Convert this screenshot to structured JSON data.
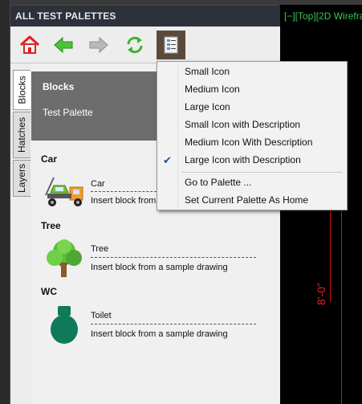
{
  "palette": {
    "title": "ALL TEST PALETTES",
    "toolbar": {
      "buttons": [
        {
          "name": "home",
          "icon": "home-icon"
        },
        {
          "name": "back",
          "icon": "arrow-left-icon"
        },
        {
          "name": "forward",
          "icon": "arrow-right-icon"
        },
        {
          "name": "refresh",
          "icon": "refresh-icon"
        },
        {
          "name": "view-options",
          "icon": "view-options-icon"
        }
      ]
    },
    "tabs": [
      "Blocks",
      "Hatches",
      "Layers"
    ],
    "active_tab": "Blocks",
    "header": {
      "title": "Blocks",
      "subtitle": "Test Palette"
    },
    "groups": [
      {
        "title": "Car",
        "item": {
          "name": "Car",
          "description": "Insert block from a sample drawing",
          "icon": "car-icon"
        }
      },
      {
        "title": "Tree",
        "item": {
          "name": "Tree",
          "description": "Insert block from a sample drawing",
          "icon": "tree-icon"
        }
      },
      {
        "title": "WC",
        "item": {
          "name": "Toilet",
          "description": "Insert block from a sample drawing",
          "icon": "toilet-icon"
        }
      }
    ]
  },
  "context_menu": {
    "items": [
      {
        "label": "Small Icon",
        "checked": false
      },
      {
        "label": "Medium Icon",
        "checked": false
      },
      {
        "label": "Large Icon",
        "checked": false
      },
      {
        "label": "Small Icon with Description",
        "checked": false
      },
      {
        "label": "Medium Icon With Description",
        "checked": false
      },
      {
        "label": "Large Icon with Description",
        "checked": true
      }
    ],
    "items2": [
      {
        "label": "Go to Palette ..."
      },
      {
        "label": "Set Current Palette As Home"
      }
    ]
  },
  "viewport": {
    "label": "[−][Top][2D Wirefra",
    "dimension_text": "8'-0\""
  },
  "colors": {
    "title_bar": "#2c313a",
    "header_bg": "#6d6d6d",
    "menu_check": "#1a4f9c",
    "viewport_label": "#35c45a",
    "dimension": "#d01010"
  }
}
